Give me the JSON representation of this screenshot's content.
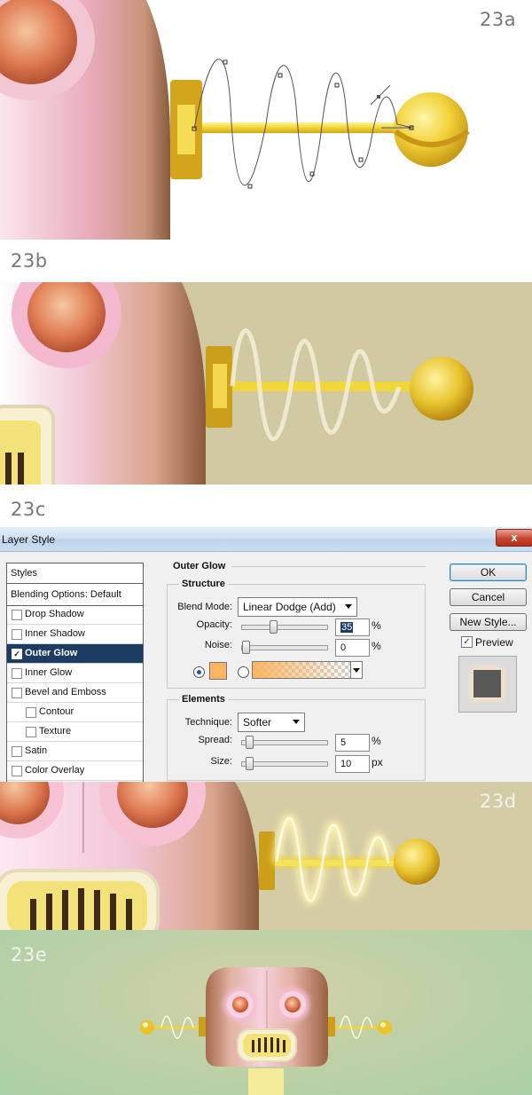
{
  "step_labels": {
    "a": "23a",
    "b": "23b",
    "c": "23c",
    "d": "23d",
    "e": "23e"
  },
  "dialog": {
    "title": "Layer Style",
    "close_glyph": "x",
    "styles_header": "Styles",
    "blending_options": "Blending Options: Default",
    "style_items": [
      {
        "label": "Drop Shadow",
        "checked": false,
        "selected": false
      },
      {
        "label": "Inner Shadow",
        "checked": false,
        "selected": false
      },
      {
        "label": "Outer Glow",
        "checked": true,
        "selected": true
      },
      {
        "label": "Inner Glow",
        "checked": false,
        "selected": false
      },
      {
        "label": "Bevel and Emboss",
        "checked": false,
        "selected": false
      },
      {
        "label": "Contour",
        "checked": false,
        "selected": false
      },
      {
        "label": "Texture",
        "checked": false,
        "selected": false
      },
      {
        "label": "Satin",
        "checked": false,
        "selected": false
      },
      {
        "label": "Color Overlay",
        "checked": false,
        "selected": false
      }
    ],
    "section_title": "Outer Glow",
    "structure": {
      "title": "Structure",
      "blend_mode_label": "Blend Mode:",
      "blend_mode_value": "Linear Dodge (Add)",
      "opacity_label": "Opacity:",
      "opacity_value": "35",
      "opacity_unit": "%",
      "noise_label": "Noise:",
      "noise_value": "0",
      "noise_unit": "%",
      "glow_color": "#fbb560"
    },
    "elements": {
      "title": "Elements",
      "technique_label": "Technique:",
      "technique_value": "Softer",
      "spread_label": "Spread:",
      "spread_value": "5",
      "spread_unit": "%",
      "size_label": "Size:",
      "size_value": "10",
      "size_unit": "px"
    },
    "buttons": {
      "ok": "OK",
      "cancel": "Cancel",
      "new_style": "New Style...",
      "preview": "Preview"
    }
  },
  "colors": {
    "panel_bg": "#d0c9a2",
    "panel_e_bg": "#b6cfa5",
    "gold": "#e8bb2a",
    "robot_pink": "#e6aeb9",
    "selection": "#1d3c63"
  }
}
